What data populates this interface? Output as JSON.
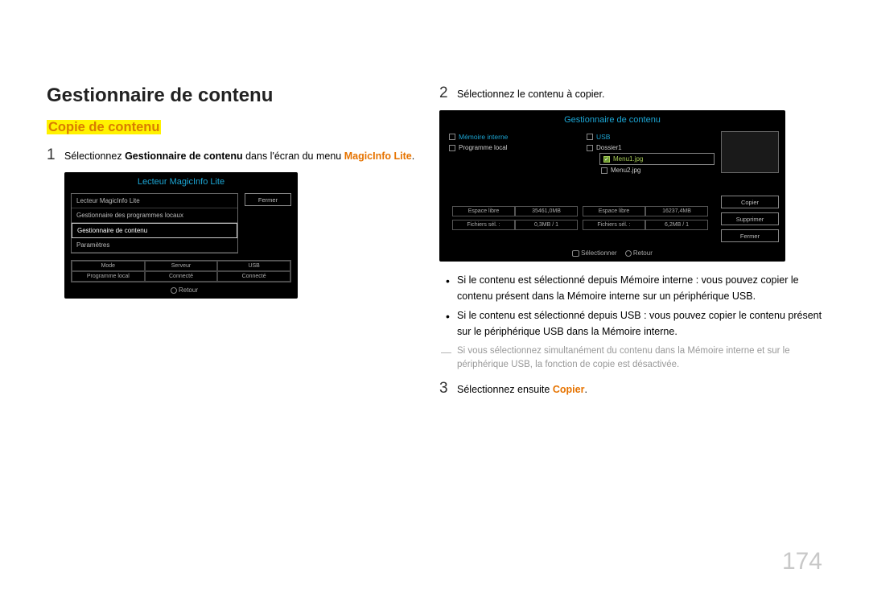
{
  "page": {
    "title": "Gestionnaire de contenu",
    "subtitle": "Copie de contenu",
    "page_number": "174"
  },
  "step1": {
    "num": "1",
    "pre": "Sélectionnez ",
    "bold1": "Gestionnaire de contenu",
    "mid": " dans l'écran du menu ",
    "bold2": "MagicInfo Lite",
    "post": "."
  },
  "shot1": {
    "title": "Lecteur MagicInfo Lite",
    "rows": {
      "r0": "Lecteur MagicInfo Lite",
      "r1": "Gestionnaire des programmes locaux",
      "r2": "Gestionnaire de contenu",
      "r3": "Paramètres"
    },
    "btn_fermer": "Fermer",
    "grid": {
      "h0": "Mode",
      "h1": "Serveur",
      "h2": "USB",
      "v0": "Programme local",
      "v1": "Connecté",
      "v2": "Connecté"
    },
    "foot": "Retour"
  },
  "step2": {
    "num": "2",
    "text": "Sélectionnez le contenu à copier."
  },
  "shot2": {
    "title": "Gestionnaire de contenu",
    "left": {
      "head": "Mémoire interne",
      "item0": "Programme local"
    },
    "right": {
      "head": "USB",
      "dossier": "Dossier1",
      "menu1": "Menu1.jpg",
      "menu2": "Menu2.jpg"
    },
    "btn_copier": "Copier",
    "btn_supprimer": "Supprimer",
    "btn_fermer": "Fermer",
    "stats": {
      "l1a": "Espace libre",
      "l1b": "35461,0MB",
      "l2a": "Fichiers sél. :",
      "l2b": "0,3MB / 1",
      "r1a": "Espace libre",
      "r1b": "16237,4MB",
      "r2a": "Fichiers sél. :",
      "r2b": "6,2MB / 1"
    },
    "foot_sel": "Sélectionner",
    "foot_ret": "Retour"
  },
  "bullets": {
    "b1_pre": "Si le contenu est sélectionné depuis ",
    "b1_mem": "Mémoire interne",
    "b1_mid": " : vous pouvez copier le contenu présent dans la ",
    "b1_mem2": "Mémoire interne",
    "b1_mid2": " sur un périphérique ",
    "b1_usb": "USB",
    "b1_post": ".",
    "b2_pre": "Si le contenu est sélectionné depuis ",
    "b2_usb": "USB",
    "b2_mid": " : vous pouvez copier le contenu présent sur le périphérique ",
    "b2_usb2": "USB",
    "b2_mid2": " dans la ",
    "b2_mem": "Mémoire interne",
    "b2_post": "."
  },
  "note": {
    "pre": "Si vous sélectionnez simultanément du contenu dans la ",
    "mem": "Mémoire interne",
    "mid": " et sur le périphérique ",
    "usb": "USB",
    "post": ", la fonction de copie est désactivée."
  },
  "step3": {
    "num": "3",
    "pre": "Sélectionnez ensuite ",
    "copier": "Copier",
    "post": "."
  }
}
